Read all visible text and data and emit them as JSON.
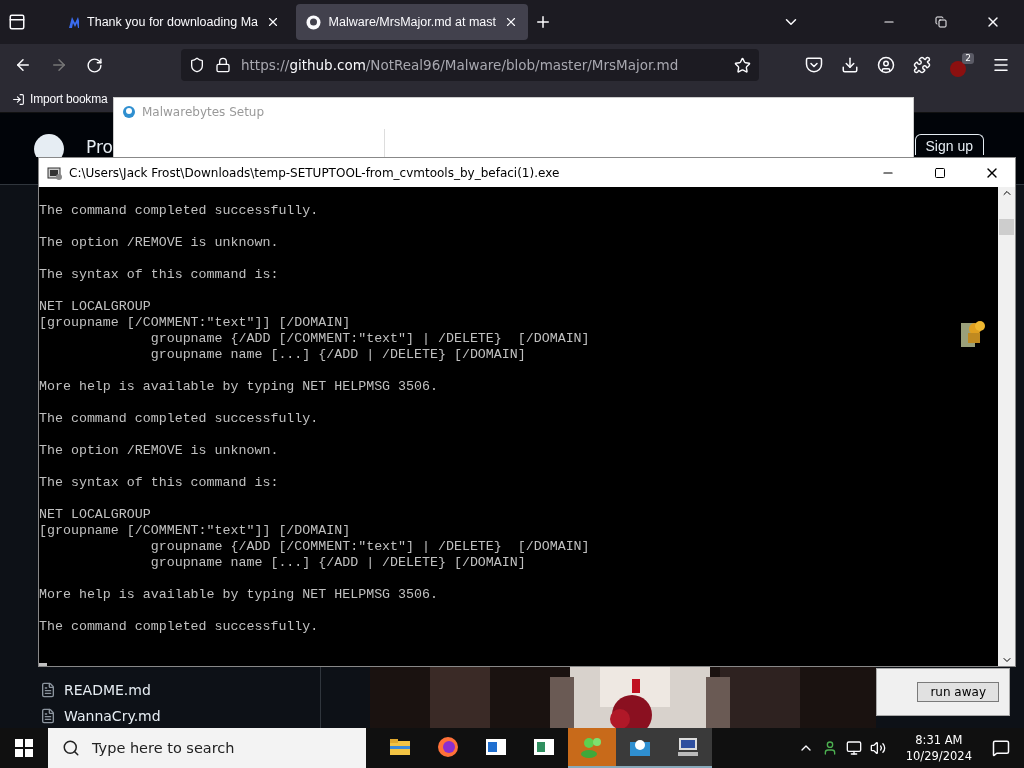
{
  "browser": {
    "tabs": [
      {
        "title": "Thank you for downloading Ma",
        "selected": false
      },
      {
        "title": "Malware/MrsMajor.md at mast",
        "selected": true
      }
    ],
    "url": {
      "scheme": "https://",
      "host": "github.com",
      "path": "/NotReal96/Malware/blob/master/MrsMajor.md"
    },
    "extension_badge": "2",
    "bookmarks": [
      "Import bookma"
    ],
    "github": {
      "header_text": "Pro",
      "sign_up": "Sign up",
      "files": [
        "README.md",
        "WannaCry.md"
      ]
    }
  },
  "installer": {
    "title": "Malwarebytes Setup"
  },
  "console": {
    "title": "C:\\Users\\Jack Frost\\Downloads\\temp-SETUPTOOL-from_cvmtools_by_befaci(1).exe",
    "paragraphs": [
      [
        "The command completed successfully."
      ],
      [
        "The option /REMOVE is unknown."
      ],
      [
        "The syntax of this command is:"
      ],
      [
        "NET LOCALGROUP",
        "[groupname [/COMMENT:\"text\"]] [/DOMAIN]",
        "              groupname {/ADD [/COMMENT:\"text\"] | /DELETE}  [/DOMAIN]",
        "              groupname name [...] {/ADD | /DELETE} [/DOMAIN]"
      ],
      [
        "More help is available by typing NET HELPMSG 3506."
      ],
      [
        "The command completed successfully."
      ],
      [
        "The option /REMOVE is unknown."
      ],
      [
        "The syntax of this command is:"
      ],
      [
        "NET LOCALGROUP",
        "[groupname [/COMMENT:\"text\"]] [/DOMAIN]",
        "              groupname {/ADD [/COMMENT:\"text\"] | /DELETE}  [/DOMAIN]",
        "              groupname name [...] {/ADD | /DELETE} [/DOMAIN]"
      ],
      [
        "More help is available by typing NET HELPMSG 3506."
      ],
      [
        "The command completed successfully."
      ]
    ]
  },
  "dialog": {
    "button": "run away"
  },
  "taskbar": {
    "search_placeholder": "Type here to search",
    "apps": [
      {
        "kind": "folder",
        "open": false,
        "flashing": false
      },
      {
        "kind": "firefox",
        "open": false,
        "flashing": false
      },
      {
        "kind": "window",
        "open": false,
        "flashing": false
      },
      {
        "kind": "document",
        "open": false,
        "flashing": false
      },
      {
        "kind": "people",
        "open": true,
        "flashing": true
      },
      {
        "kind": "installer",
        "open": true,
        "flashing": false
      },
      {
        "kind": "computer",
        "open": true,
        "flashing": false
      }
    ],
    "time": "8:31 AM",
    "date": "10/29/2024"
  }
}
